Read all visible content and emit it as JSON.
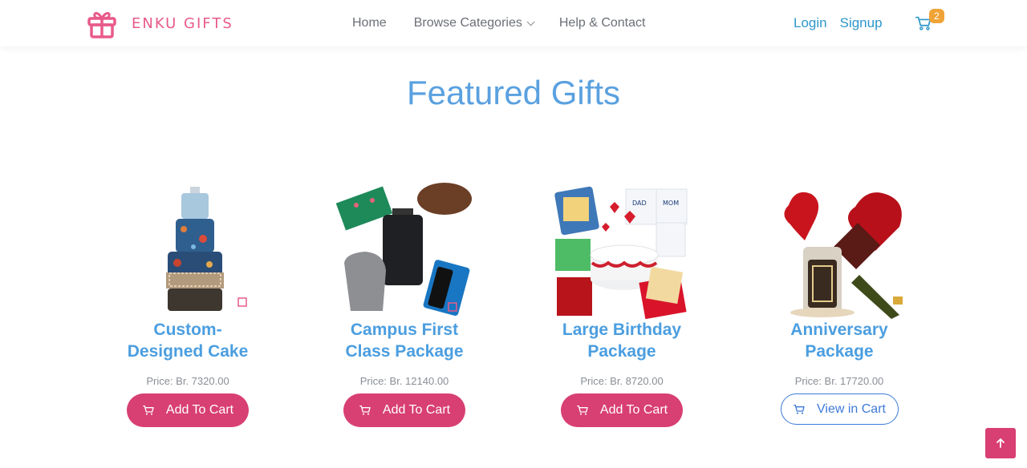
{
  "brand": {
    "name": "ENKU GIFTS",
    "icon": "gift-icon",
    "color": "#e85a8a"
  },
  "nav": {
    "items": [
      {
        "label": "Home"
      },
      {
        "label": "Browse Categories",
        "icon": "chevron-down-icon"
      },
      {
        "label": "Help & Contact"
      }
    ]
  },
  "auth": {
    "login": "Login",
    "signup": "Signup"
  },
  "cart": {
    "icon": "cart-icon",
    "count": "2"
  },
  "featured": {
    "title": "Featured Gifts",
    "products": [
      {
        "name": "Custom-Designed Cake",
        "name_line1": "Custom-",
        "name_line2": "Designed Cake",
        "price": "Price: Br. 7320.00",
        "action": "Add To Cart"
      },
      {
        "name": "Campus First Class Package",
        "name_line1": "Campus First",
        "name_line2": "Class Package",
        "price": "Price: Br. 12140.00",
        "action": "Add To Cart"
      },
      {
        "name": "Large Birthday Package",
        "name_line1": "Large Birthday",
        "name_line2": "Package",
        "price": "Price: Br. 8720.00",
        "action": "Add To Cart"
      },
      {
        "name": "Anniversary Package",
        "name_line1": "Anniversary",
        "name_line2": "Package",
        "price": "Price: Br. 17720.00",
        "action": "View in Cart"
      }
    ]
  },
  "colors": {
    "accent": "#d83f73",
    "title": "#5aa1e0",
    "product_name": "#4b9ee0",
    "link": "#2c97c9",
    "badge": "#f0a336"
  },
  "scroll_top": {
    "icon": "arrow-up-icon"
  }
}
